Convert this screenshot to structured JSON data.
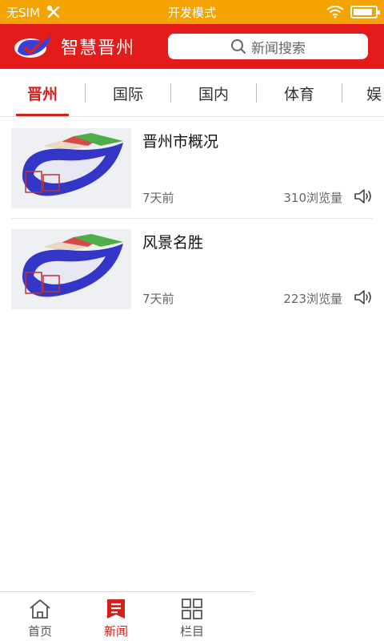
{
  "status_bar": {
    "carrier": "无SIM",
    "mode": "开发模式",
    "battery_level": 0.9
  },
  "header": {
    "app_title": "智慧晋州",
    "search_placeholder": "新闻搜索"
  },
  "tabs": [
    {
      "label": "晋州",
      "active": true
    },
    {
      "label": "国际",
      "active": false
    },
    {
      "label": "国内",
      "active": false
    },
    {
      "label": "体育",
      "active": false
    },
    {
      "label": "娱",
      "active": false
    }
  ],
  "news": [
    {
      "title": "晋州市概况",
      "time": "7天前",
      "views": "310浏览量"
    },
    {
      "title": "风景名胜",
      "time": "7天前",
      "views": "223浏览量"
    }
  ],
  "bottom_nav": [
    {
      "label": "首页",
      "icon": "home-icon",
      "active": false
    },
    {
      "label": "新闻",
      "icon": "news-icon",
      "active": true
    },
    {
      "label": "栏目",
      "icon": "grid-icon",
      "active": false
    }
  ],
  "colors": {
    "status_bar": "#f5a300",
    "brand_red": "#e31b1b",
    "active_tab": "#d2201b"
  }
}
